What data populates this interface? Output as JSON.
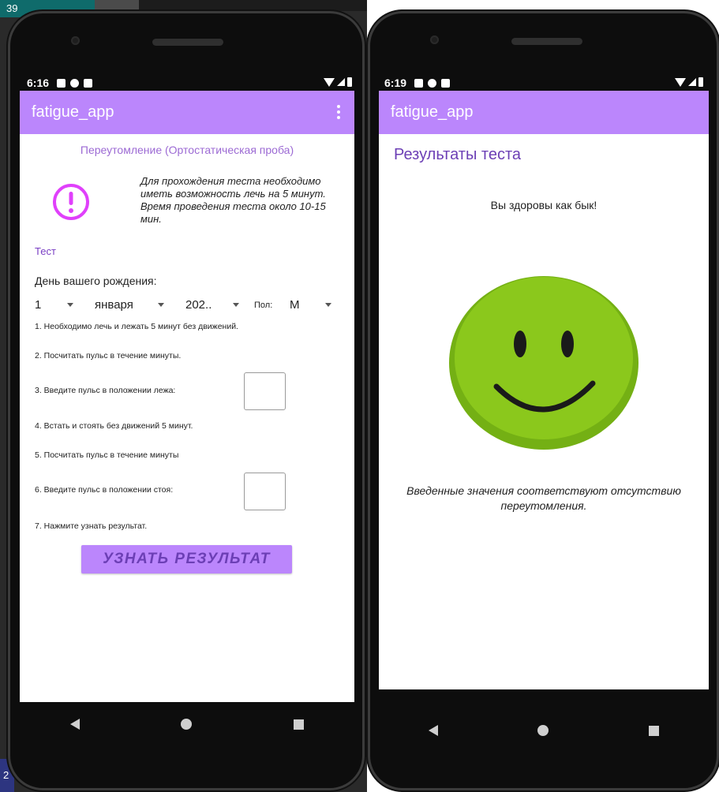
{
  "background": {
    "corner_top_left": "39",
    "corner_bottom_left": "2"
  },
  "left_phone": {
    "status": {
      "time": "6:16"
    },
    "app_title": "fatigue_app",
    "subtitle": "Переутомление (Ортостатическая проба)",
    "info": "Для прохождения теста необходимо иметь возможность лечь на 5 минут. Время проведения теста около 10-15 мин.",
    "test_label": "Тест",
    "birthday_label": "День вашего рождения:",
    "day_value": "1",
    "month_value": "января",
    "year_value": "202..",
    "gender_label": "Пол:",
    "gender_value": "М",
    "steps": [
      "1. Необходимо лечь и лежать 5 минут без движений.",
      "2. Посчитать пульс в течение минуты.",
      "3. Введите пульс в положении лежа:",
      "4. Встать и стоять без движений 5 минут.",
      "5. Посчитать пульс в течение минуты",
      "6. Введите пульс в положении стоя:",
      "7. Нажмите узнать результат."
    ],
    "result_button": "УЗНАТЬ РЕЗУЛЬТАТ"
  },
  "right_phone": {
    "status": {
      "time": "6:19"
    },
    "app_title": "fatigue_app",
    "results_title": "Результаты теста",
    "healthy_text": "Вы здоровы как бык!",
    "conclusion": "Введенные значения соответствуют отсутствию переутомления."
  },
  "colors": {
    "app_bar": "#bb86fc",
    "accent_text": "#6c3fb5",
    "warning_icon": "#e040fb",
    "smiley_face": "#8bc81c",
    "smiley_rim": "#74b014"
  },
  "icons": {
    "warning": "exclamation-circle-icon",
    "overflow_menu": "more-vert-icon",
    "smiley": "smiley-face-icon",
    "nav_back": "back-triangle-icon",
    "nav_home": "home-circle-icon",
    "nav_recents": "recents-square-icon"
  }
}
